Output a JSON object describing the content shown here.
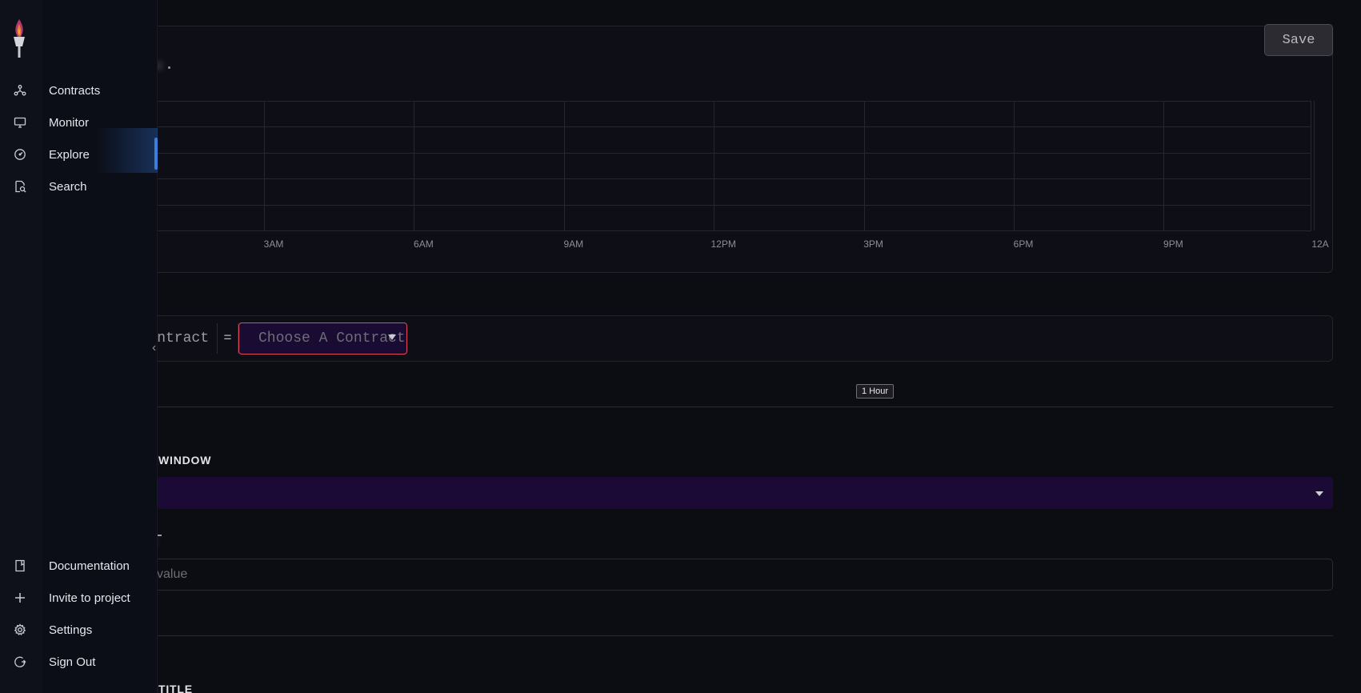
{
  "toolbar": {
    "save_label": "Save"
  },
  "chart_data": {
    "type": "line",
    "title": "",
    "x_tick_labels": [
      "3AM",
      "6AM",
      "9AM",
      "12PM",
      "3PM",
      "6PM",
      "9PM",
      "12A"
    ],
    "series": [],
    "grid": true
  },
  "query": {
    "filter_key": "ntract",
    "operator": "=",
    "contract_placeholder": "Choose A Contract"
  },
  "time_range": {
    "badge": "1 Hour"
  },
  "form": {
    "window_label_fragment": "WINDOW",
    "value_placeholder": "value",
    "title_label_fragment": "TITLE"
  },
  "nav": {
    "items": [
      {
        "label": "Contracts",
        "icon": "contracts-icon"
      },
      {
        "label": "Monitor",
        "icon": "monitor-icon"
      },
      {
        "label": "Explore",
        "icon": "explore-icon"
      },
      {
        "label": "Search",
        "icon": "search-icon"
      }
    ],
    "bottom": [
      {
        "label": "Documentation",
        "icon": "book-icon"
      },
      {
        "label": "Invite to project",
        "icon": "plus-icon"
      },
      {
        "label": "Settings",
        "icon": "gear-icon"
      },
      {
        "label": "Sign Out",
        "icon": "sign-out-icon"
      }
    ]
  },
  "colors": {
    "accent": "#3e7de0",
    "select_bg": "#1a0b33",
    "select_border": "#e04a5a"
  }
}
